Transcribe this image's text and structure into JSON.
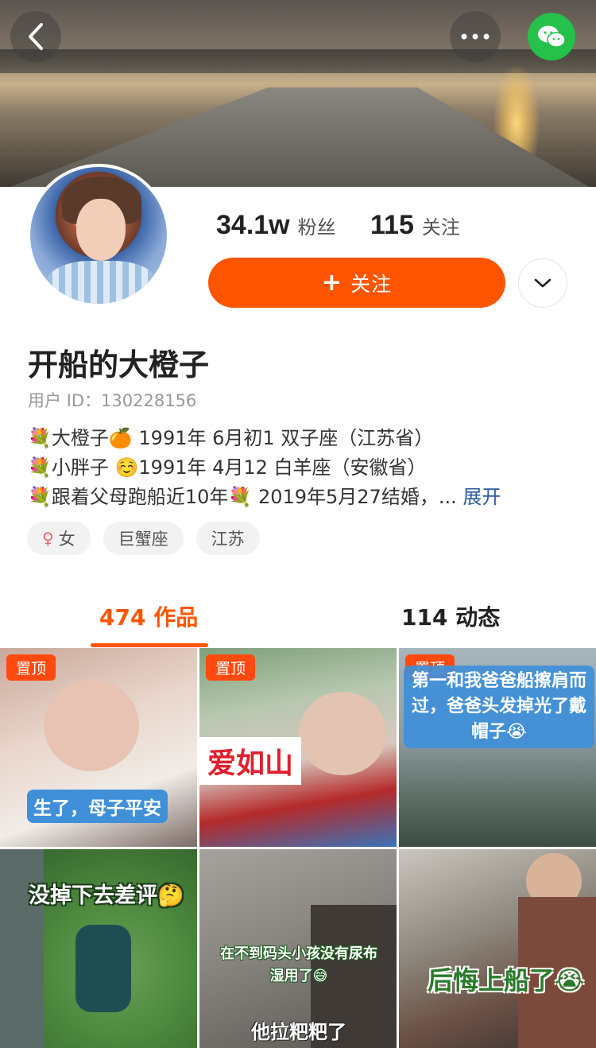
{
  "header": {
    "back_icon": "chevron-left-icon",
    "more_icon": "more-dots-icon",
    "share_icon": "wechat-icon",
    "share_color": "#25c14a"
  },
  "profile": {
    "fans_count": "34.1w",
    "fans_label": "粉丝",
    "follow_count": "115",
    "follow_label": "关注",
    "follow_button": "关注",
    "follow_button_color": "#ff5500",
    "name": "开船的大橙子",
    "user_id": "用户 ID：130228156",
    "bio": [
      {
        "icon": "💐",
        "text": "大橙子🍊 1991年  6月初1   双子座（江苏省）"
      },
      {
        "icon": "💐",
        "text": "小胖子 ☺️1991年  4月12     白羊座（安徽省）"
      },
      {
        "icon": "💐",
        "text": "跟着父母跑船近10年💐 2019年5月27结婚，..."
      }
    ],
    "expand_label": "展开",
    "tags": [
      "女",
      "巨蟹座",
      "江苏"
    ]
  },
  "tabs": [
    {
      "label": "474 作品",
      "active": true
    },
    {
      "label": "114 动态",
      "active": false
    }
  ],
  "accent_color": "#ff5500",
  "videos": [
    {
      "pinned": true,
      "pin_label": "置顶",
      "caption": "生了，母子平安"
    },
    {
      "pinned": true,
      "pin_label": "置顶",
      "caption": "爱如山"
    },
    {
      "pinned": true,
      "pin_label": "置顶",
      "caption": "第一和我爸爸船擦肩而过，爸爸头发掉光了戴帽子😭"
    },
    {
      "pinned": false,
      "caption": "没掉下去差评🤔"
    },
    {
      "pinned": false,
      "caption": "在不到码头小孩没有尿布湿用了😅",
      "caption2": "他拉粑粑了"
    },
    {
      "pinned": false,
      "caption": "后悔上船了😭"
    }
  ]
}
